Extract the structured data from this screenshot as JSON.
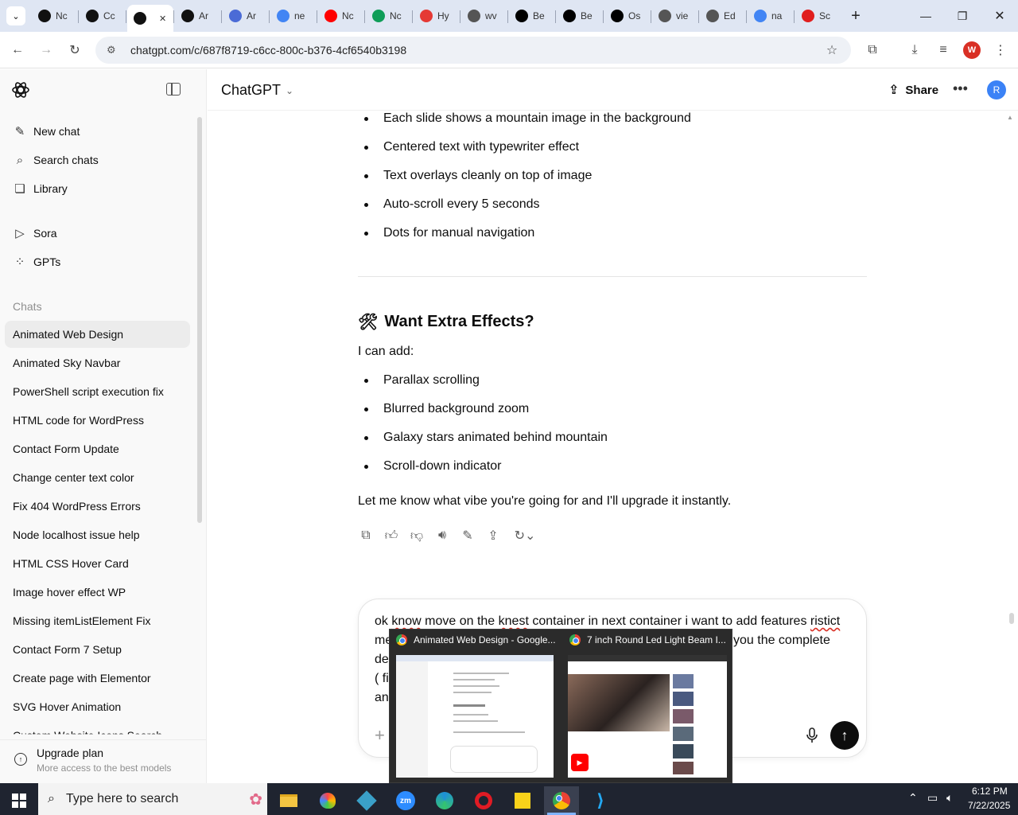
{
  "browser": {
    "tabs": [
      {
        "label": "Nc",
        "icon": "chatgpt-icon",
        "color": "#111111"
      },
      {
        "label": "Cc",
        "icon": "chatgpt-icon",
        "color": "#111111"
      },
      {
        "label": "",
        "icon": "chatgpt-icon",
        "color": "#111111",
        "active": true
      },
      {
        "label": "Ar",
        "icon": "chatgpt-icon",
        "color": "#111111"
      },
      {
        "label": "Ar",
        "icon": "gemini-icon",
        "color": "#4b6bd6"
      },
      {
        "label": "ne",
        "icon": "google-icon",
        "color": "#4285f4"
      },
      {
        "label": "Nc",
        "icon": "youtube-icon",
        "color": "#ff0000"
      },
      {
        "label": "Nc",
        "icon": "w-icon",
        "color": "#0f9d58"
      },
      {
        "label": "Hy",
        "icon": "tag-icon",
        "color": "#e53935"
      },
      {
        "label": "wv",
        "icon": "linkedin-icon",
        "color": "#555555"
      },
      {
        "label": "Be",
        "icon": "x-icon",
        "color": "#000000"
      },
      {
        "label": "Be",
        "icon": "x-icon",
        "color": "#000000"
      },
      {
        "label": "Os",
        "icon": "spark-icon",
        "color": "#000000"
      },
      {
        "label": "vie",
        "icon": "globe-icon",
        "color": "#555555"
      },
      {
        "label": "Ed",
        "icon": "globe-icon",
        "color": "#555555"
      },
      {
        "label": "na",
        "icon": "google-icon",
        "color": "#4285f4"
      },
      {
        "label": "Sc",
        "icon": "adobe-icon",
        "color": "#e01e1e"
      }
    ],
    "url": "chatgpt.com/c/687f8719-c6cc-800c-b376-4cf6540b3198",
    "profile_initial": "W",
    "profile_color": "#d93025"
  },
  "sidebar": {
    "nav": [
      {
        "label": "New chat",
        "icon": "edit-icon"
      },
      {
        "label": "Search chats",
        "icon": "search-icon"
      },
      {
        "label": "Library",
        "icon": "library-icon"
      },
      {
        "label": "Sora",
        "icon": "play-icon"
      },
      {
        "label": "GPTs",
        "icon": "grid-icon"
      }
    ],
    "chats_heading": "Chats",
    "chats": [
      "Animated Web Design",
      "Animated Sky Navbar",
      "PowerShell script execution fix",
      "HTML code for WordPress",
      "Contact Form Update",
      "Change center text color",
      "Fix 404 WordPress Errors",
      "Node localhost issue help",
      "HTML CSS Hover Card",
      "Image hover effect WP",
      "Missing itemListElement Fix",
      "Contact Form 7 Setup",
      "Create page with Elementor",
      "SVG Hover Animation",
      "Custom Website Icons Search"
    ],
    "upgrade": {
      "title": "Upgrade plan",
      "subtitle": "More access to the best models"
    }
  },
  "header": {
    "model": "ChatGPT",
    "share_label": "Share",
    "avatar_initial": "R",
    "avatar_color": "#3b82f6"
  },
  "message": {
    "bullets_top": [
      "Each slide shows a mountain image in the background",
      "Centered text with typewriter effect",
      "Text overlays cleanly on top of image",
      "Auto-scroll every 5 seconds",
      "Dots for manual navigation"
    ],
    "section_emoji": "🛠",
    "section_title": "Want Extra Effects?",
    "intro": "I can add:",
    "bullets_bottom": [
      "Parallax scrolling",
      "Blurred background zoom",
      "Galaxy stars animated behind mountain",
      "Scroll-down indicator"
    ],
    "closing": "Let me know what vibe you're going for and I'll upgrade it instantly."
  },
  "composer": {
    "line1_a": "ok ",
    "line1_know": "know",
    "line1_b": " move on the ",
    "line1_knest": "knest",
    "line1_c": " container in next container i want to add features ",
    "line1_ristict": "ristict",
    "line2_left": "me",
    "line2_right": "you the complete",
    "line3_left": "de",
    "line4_left": "( fi",
    "line5_left": "an"
  },
  "preview": {
    "windows": [
      {
        "title": "Animated Web Design - Google..."
      },
      {
        "title": "7 inch Round Led Light Beam I..."
      }
    ]
  },
  "taskbar": {
    "search_placeholder": "Type here to search",
    "time": "6:12 PM",
    "date": "7/22/2025"
  }
}
